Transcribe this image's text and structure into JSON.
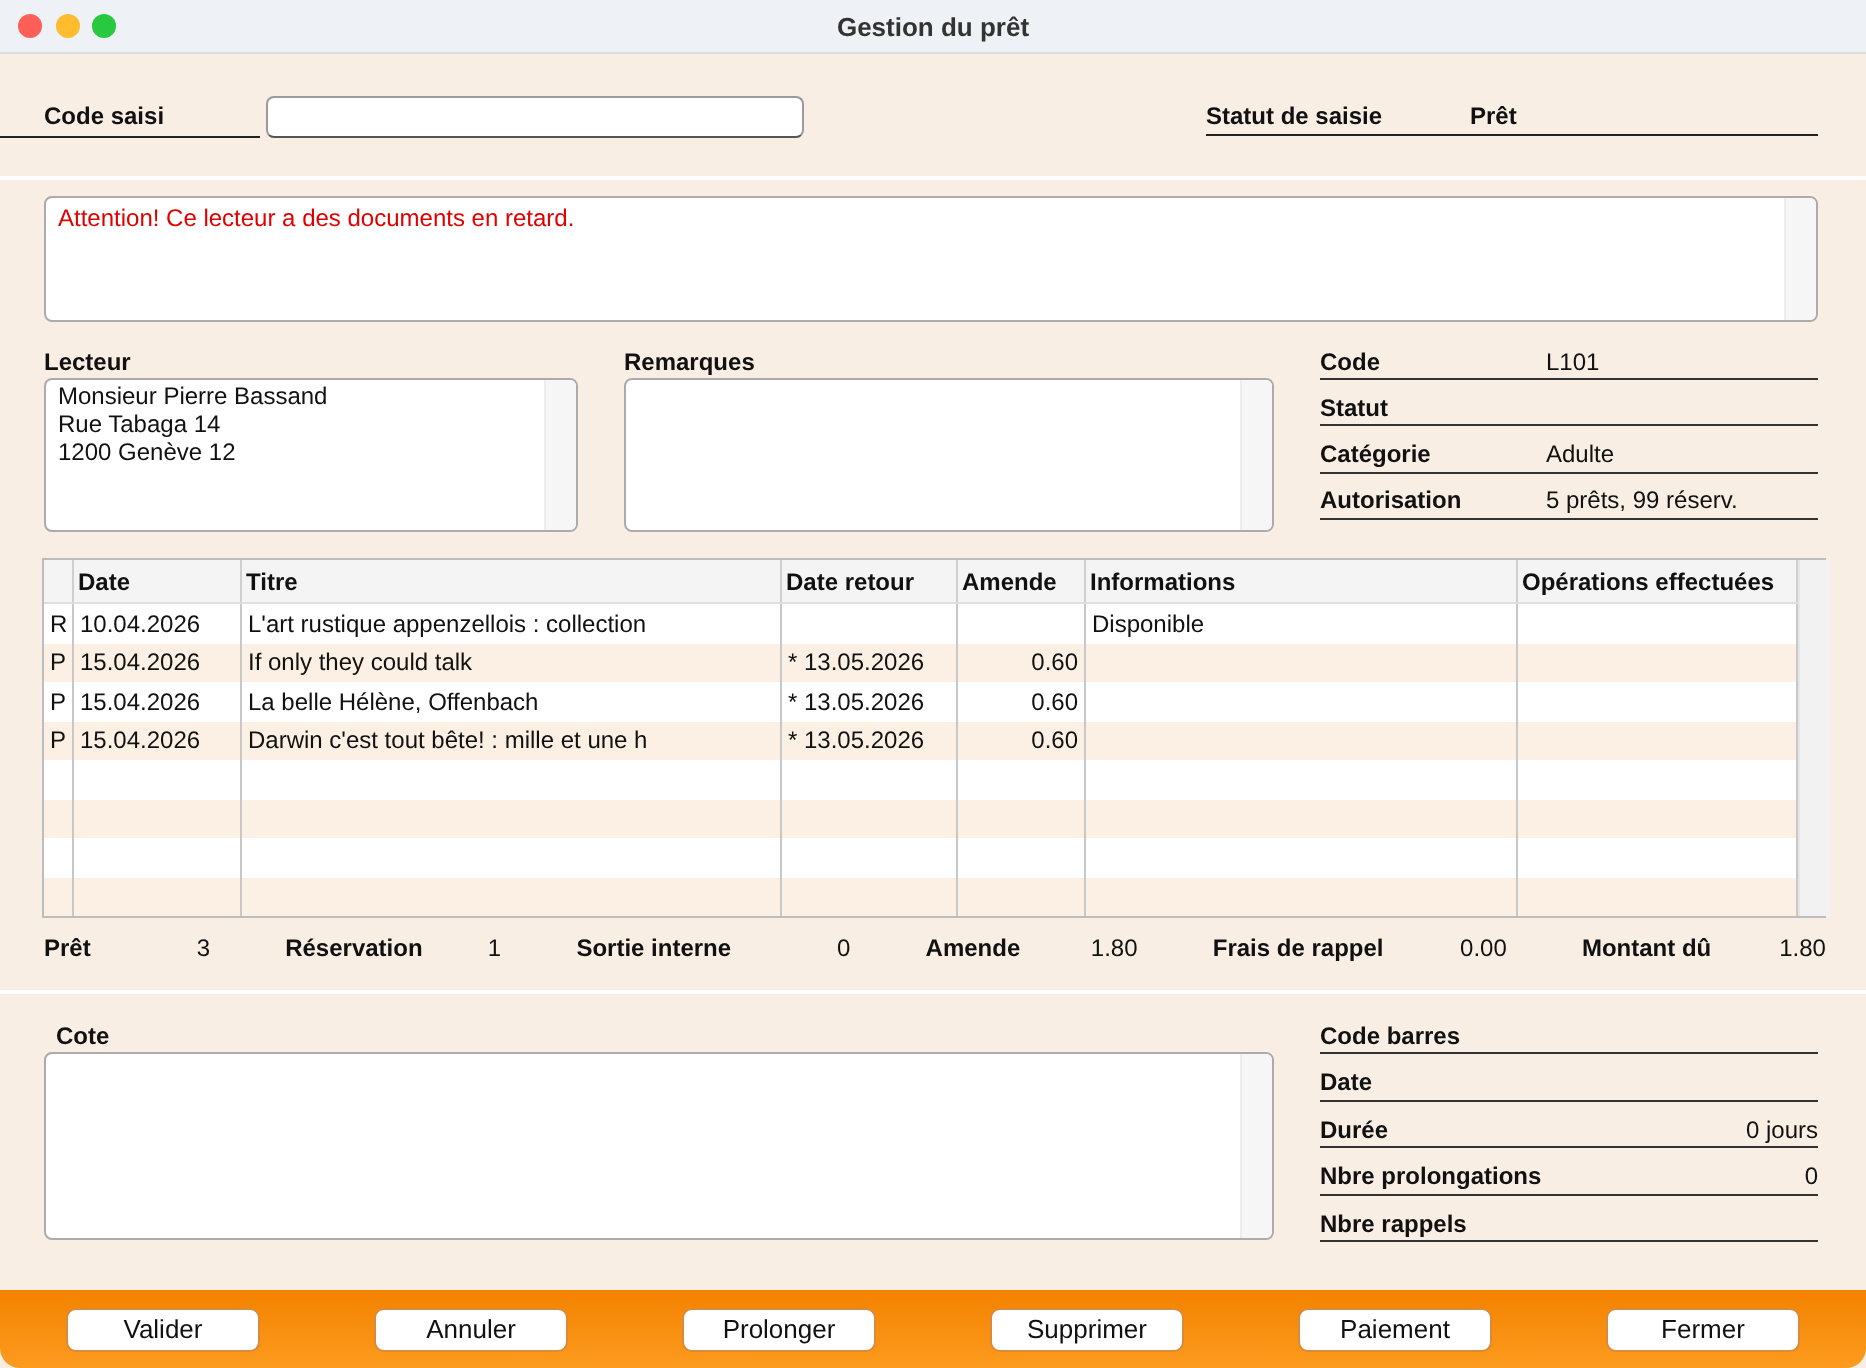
{
  "window": {
    "title": "Gestion du prêt"
  },
  "entry": {
    "label": "Code saisi",
    "status_label": "Statut de saisie",
    "status_value": "Prêt"
  },
  "alert": {
    "message": "Attention! Ce lecteur a des documents en retard."
  },
  "reader": {
    "label": "Lecteur",
    "address": [
      "Monsieur Pierre Bassand",
      "Rue Tabaga 14",
      "1200 Genève 12"
    ]
  },
  "remarks": {
    "label": "Remarques"
  },
  "reader_info": [
    {
      "label": "Code",
      "value": "L101"
    },
    {
      "label": "Statut"
    },
    {
      "label": "Catégorie",
      "value": "Adulte"
    },
    {
      "label": "Autorisation",
      "value": "5 prêts, 99 réserv."
    }
  ],
  "loans": {
    "columns": [
      "Date",
      "Titre",
      "Date retour",
      "Amende",
      "Informations",
      "Opérations effectuées"
    ],
    "rows": [
      {
        "column_1": "R",
        "date": "10.04.2026",
        "title": "L'art rustique appenzellois : collection",
        "information": "Disponible"
      },
      {
        "column_1": "P",
        "date": "15.04.2026",
        "title": "If only they could talk",
        "return_date": "* 13.05.2026",
        "fine": "0.60"
      },
      {
        "column_1": "P",
        "date": "15.04.2026",
        "title": "La belle Hélène, Offenbach",
        "return_date": "* 13.05.2026",
        "fine": "0.60"
      },
      {
        "column_1": "P",
        "date": "15.04.2026",
        "title": "Darwin c'est tout bête! : mille et une h",
        "return_date": "* 13.05.2026",
        "fine": "0.60"
      }
    ]
  },
  "totals": [
    {
      "label": "Prêt",
      "value": "3"
    },
    {
      "label": "Réservation",
      "value": "1"
    },
    {
      "label": "Sortie interne",
      "value": "0"
    },
    {
      "label": "Amende",
      "value": "1.80"
    },
    {
      "label": "Frais de rappel",
      "value": "0.00"
    },
    {
      "label": "Montant dû",
      "value": "1.80"
    }
  ],
  "copy": {
    "label": "Cote",
    "info": [
      {
        "label": "Code barres"
      },
      {
        "label": "Date"
      },
      {
        "label": "Durée",
        "value": "0 jours"
      },
      {
        "label": "Nbre prolongations",
        "value": "0"
      },
      {
        "label": "Nbre rappels"
      }
    ]
  },
  "buttons": [
    "Valider",
    "Annuler",
    "Prolonger",
    "Supprimer",
    "Paiement",
    "Fermer"
  ]
}
